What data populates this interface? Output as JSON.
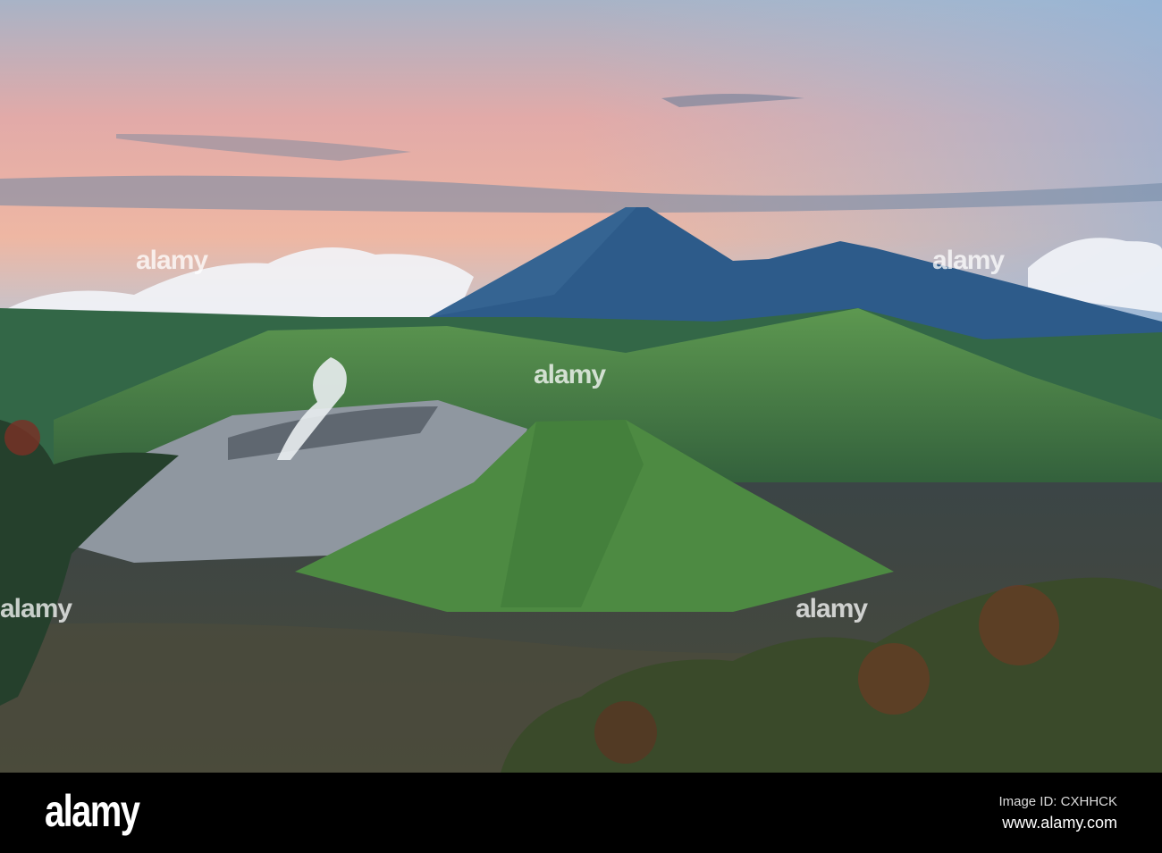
{
  "watermark": {
    "text": "alamy"
  },
  "footer": {
    "logo": "alamy",
    "image_id": "Image ID: CXHHCK",
    "website": "www.alamy.com"
  },
  "colors": {
    "sky_top": "#a8b3c6",
    "sky_pink": "#e7a8a6",
    "mountain_blue": "#2c5a8c",
    "caldera_green": "#4f8a45",
    "sand_sea": "#3e4644"
  }
}
